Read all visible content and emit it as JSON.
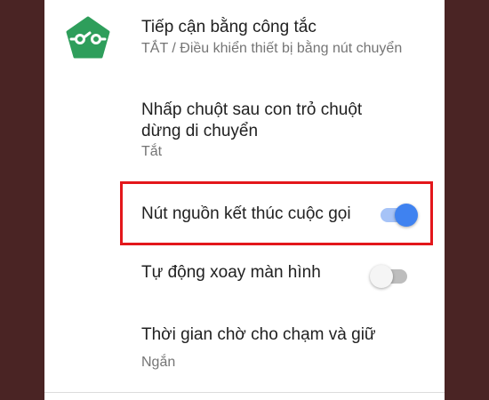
{
  "switch_access": {
    "title": "Tiếp cận bằng công tắc",
    "summary": "TẮT / Điều khiển thiết bị bằng nút chuyển",
    "icon": "switch-access-icon",
    "icon_color": "#2e9e5b"
  },
  "settings": {
    "autoclick": {
      "title_line1": "Nhấp chuột sau con trỏ chuột",
      "title_line2": "dừng di chuyển",
      "summary": "Tắt"
    },
    "power_button_ends_call": {
      "title": "Nút nguồn kết thúc cuộc gọi",
      "state": "on"
    },
    "auto_rotate": {
      "title": "Tự động xoay màn hình",
      "state": "off"
    },
    "touch_hold_delay": {
      "title": "Thời gian chờ cho chạm và giữ",
      "summary": "Ngắn"
    }
  },
  "colors": {
    "toggle_on": "#3f82f0",
    "highlight": "#e3171b",
    "side_background": "#4a2424"
  }
}
